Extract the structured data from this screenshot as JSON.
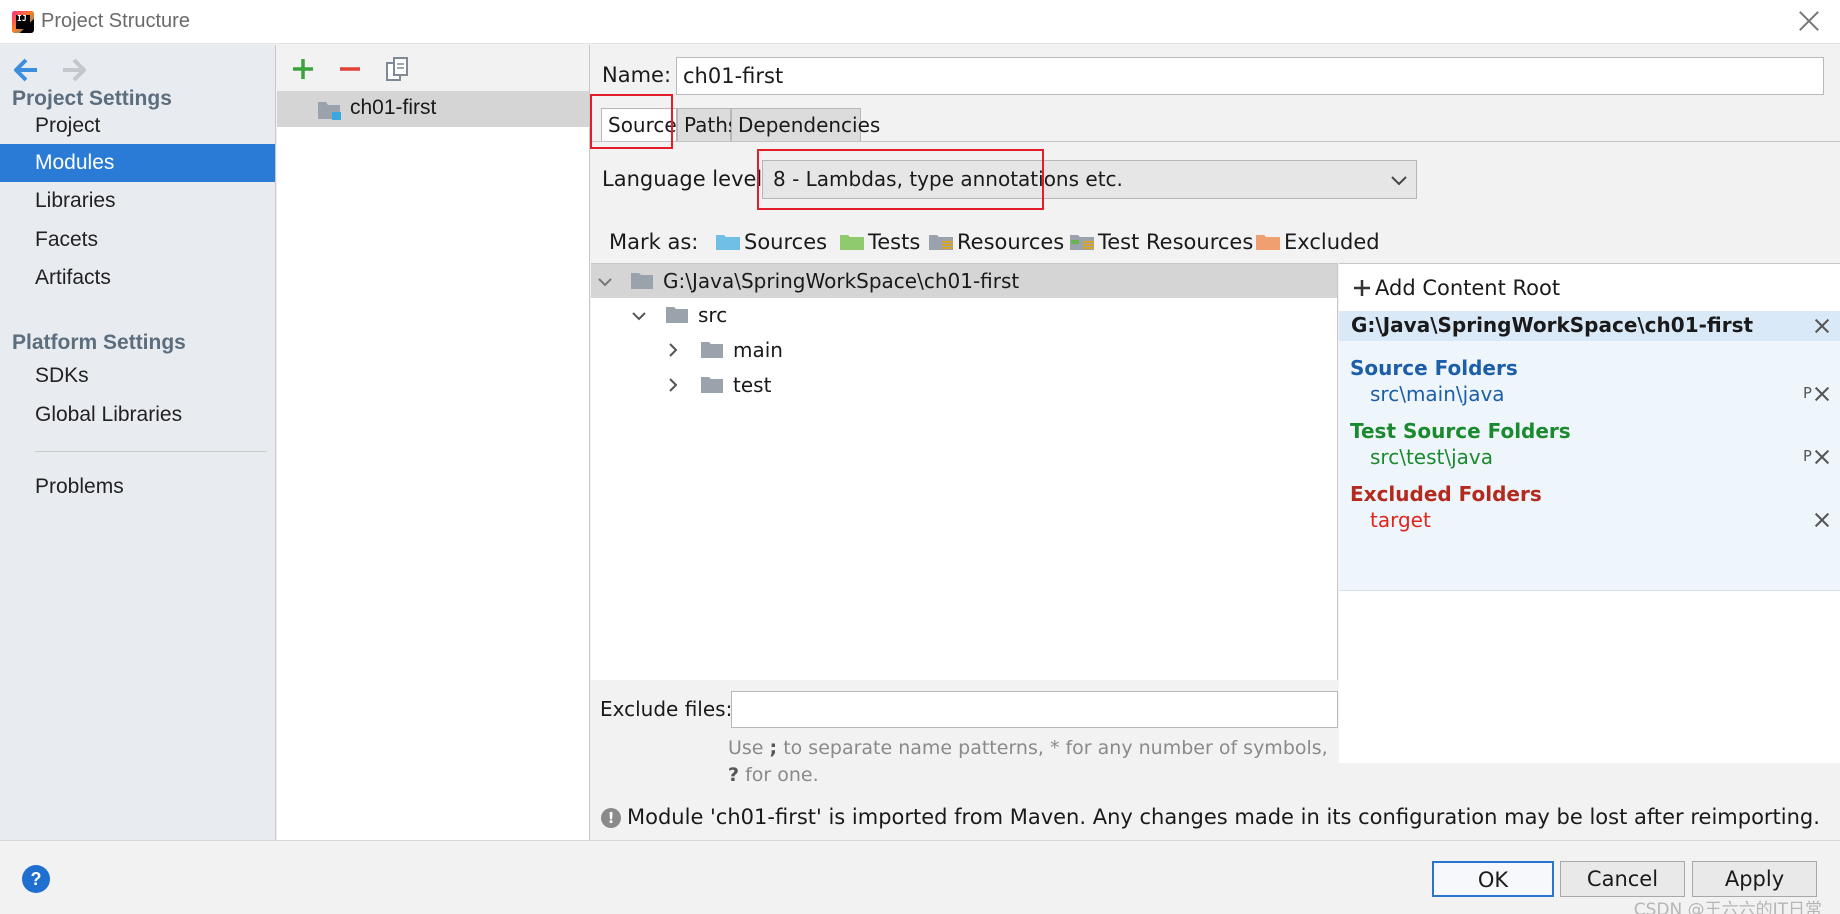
{
  "window": {
    "title": "Project Structure"
  },
  "sidebar": {
    "project_settings_header": "Project Settings",
    "platform_settings_header": "Platform Settings",
    "items": [
      {
        "label": "Project"
      },
      {
        "label": "Modules"
      },
      {
        "label": "Libraries"
      },
      {
        "label": "Facets"
      },
      {
        "label": "Artifacts"
      },
      {
        "label": "SDKs"
      },
      {
        "label": "Global Libraries"
      },
      {
        "label": "Problems"
      }
    ]
  },
  "modules": {
    "items": [
      {
        "label": "ch01-first"
      }
    ]
  },
  "main": {
    "name_label": "Name:",
    "name_value": "ch01-first",
    "tabs": [
      {
        "label": "Sources"
      },
      {
        "label": "Paths"
      },
      {
        "label": "Dependencies"
      }
    ],
    "language_level_label": "Language level:",
    "language_level_value": "8 - Lambdas, type annotations etc.",
    "mark_as_label": "Mark as:",
    "mark_as": [
      {
        "label": "Sources",
        "color": "#6fbfe6"
      },
      {
        "label": "Tests",
        "color": "#8fca6e"
      },
      {
        "label": "Resources",
        "color": "#9aa3ab"
      },
      {
        "label": "Test Resources",
        "color": "#9aa3ab"
      },
      {
        "label": "Excluded",
        "color": "#f0a070"
      }
    ],
    "tree": [
      {
        "label": "G:\\Java\\SpringWorkSpace\\ch01-first"
      },
      {
        "label": "src"
      },
      {
        "label": "main"
      },
      {
        "label": "test"
      }
    ],
    "add_content_root": "Add Content Root",
    "content_root": {
      "path": "G:\\Java\\SpringWorkSpace\\ch01-first",
      "source_folders_header": "Source Folders",
      "source_folder": "src\\main\\java",
      "test_source_folders_header": "Test Source Folders",
      "test_source_folder": "src\\test\\java",
      "excluded_folders_header": "Excluded Folders",
      "excluded_folder": "target",
      "pkg_icon_text": "P"
    },
    "exclude_files_label": "Exclude files:",
    "exclude_files_value": "",
    "hint_line1_a": "Use ",
    "hint_sep": ";",
    "hint_line1_b": " to separate name patterns, * for any number of symbols,",
    "hint_q": "?",
    "hint_line2": " for one.",
    "info_message": "Module 'ch01-first' is imported from Maven. Any changes made in its configuration may be lost after reimporting."
  },
  "buttons": {
    "ok": "OK",
    "cancel": "Cancel",
    "apply": "Apply",
    "help": "?"
  },
  "watermark": "CSDN @王六六的IT日常",
  "colors": {
    "selection": "#2a7bd6",
    "source_blue": "#1d5ea8",
    "test_green": "#1b8a2e",
    "excluded_red": "#b32a1e",
    "highlight_red": "#e51d2a"
  }
}
